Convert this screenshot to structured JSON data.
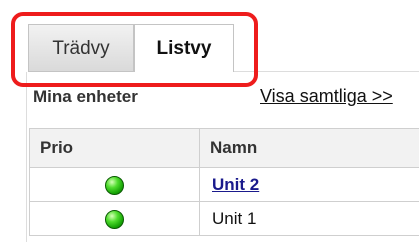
{
  "tabs": [
    {
      "label": "Trädvy",
      "active": false
    },
    {
      "label": "Listvy",
      "active": true
    }
  ],
  "section": {
    "title": "Mina enheter",
    "show_all": "Visa samtliga >>"
  },
  "table": {
    "headers": [
      "Prio",
      "Namn"
    ],
    "rows": [
      {
        "status": "green",
        "name": "Unit 2",
        "link": true
      },
      {
        "status": "green",
        "name": "Unit 1",
        "link": false
      }
    ]
  },
  "colors": {
    "highlight": "#ee1c1c",
    "status_ok": "#2ecc1a",
    "link": "#1a1a8c"
  }
}
